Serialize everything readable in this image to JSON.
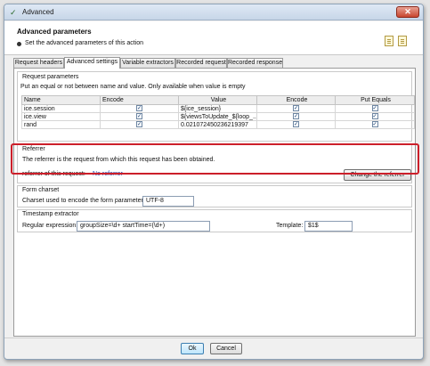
{
  "window": {
    "title": "Advanced",
    "close_label": "✕"
  },
  "header": {
    "title": "Advanced parameters",
    "subtitle": "Set the advanced parameters of this action"
  },
  "tabs": [
    {
      "label": "Request headers",
      "active": false
    },
    {
      "label": "Advanced settings",
      "active": true
    },
    {
      "label": "Variable extractors",
      "active": false
    },
    {
      "label": "Recorded request",
      "active": false
    },
    {
      "label": "Recorded response",
      "active": false
    }
  ],
  "request_parameters": {
    "title": "Request parameters",
    "hint": "Put an equal or not between name and value. Only available when value is empty",
    "columns": [
      "Name",
      "Encode",
      "Value",
      "Encode",
      "Put Equals"
    ],
    "rows": [
      {
        "name": "ice.session",
        "encode1": true,
        "value": "${ice_session}",
        "encode2": true,
        "put_equals": true
      },
      {
        "name": "ice.view",
        "encode1": true,
        "value": "${viewsToUpdate_${loop_...",
        "encode2": true,
        "put_equals": true
      },
      {
        "name": "rand",
        "encode1": true,
        "value": "0.021072450236219397",
        "encode2": true,
        "put_equals": true
      }
    ]
  },
  "referrer": {
    "title": "Referrer",
    "description": "The referrer is the request from which this request has been obtained.",
    "label": "referrer of this request:",
    "value": "No referrer",
    "button": "Change the referrer"
  },
  "form_charset": {
    "title": "Form charset",
    "label": "Charset used to encode the form parameters:",
    "value": "UTF-8"
  },
  "timestamp_extractor": {
    "title": "Timestamp extractor",
    "regex_label": "Regular expression:",
    "regex_value": "groupSize=\\d+ startTime=(\\d+)",
    "template_label": "Template:",
    "template_value": "$1$"
  },
  "footer": {
    "ok_label": "Ok",
    "cancel_label": "Cancel"
  },
  "colors": {
    "highlight": "#cc1f2a",
    "link": "#1a3fa8"
  }
}
